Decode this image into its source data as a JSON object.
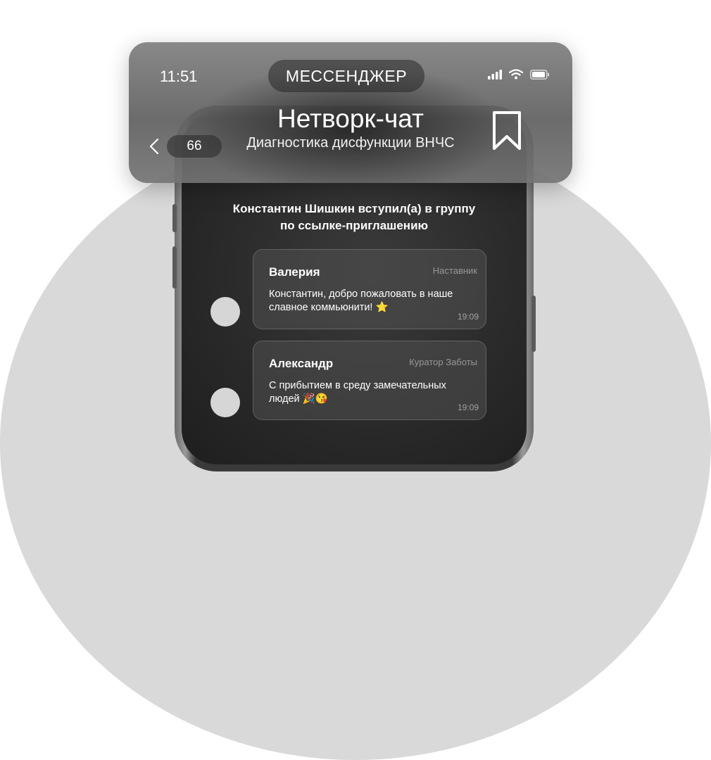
{
  "status_bar": {
    "time": "11:51",
    "app_label": "МЕССЕНДЖЕР",
    "signal_icon": "signal-bars-icon",
    "wifi_icon": "wifi-icon",
    "battery_icon": "battery-icon"
  },
  "header": {
    "title": "Нетворк-чат",
    "subtitle": "Диагностика дисфункции ВНЧС",
    "back_count": "66",
    "back_icon": "chevron-left-icon",
    "bookmark_icon": "bookmark-icon"
  },
  "chat": {
    "system_message_line1": "Константин Шишкин вступил(а) в группу",
    "system_message_line2": "по ссылке-приглашению",
    "messages": [
      {
        "name": "Валерия",
        "role": "Наставник",
        "text": "Константин, добро пожаловать в наше славное коммьюнити! ⭐",
        "time": "19:09"
      },
      {
        "name": "Александр",
        "role": "Куратор Заботы",
        "text": "С прибытием в среду замечательных людей 🎉😘",
        "time": "19:09"
      }
    ]
  },
  "colors": {
    "background_circle": "#d9d9d9",
    "screen": "#2a2a2a",
    "avatar": "#d6d6d6"
  }
}
